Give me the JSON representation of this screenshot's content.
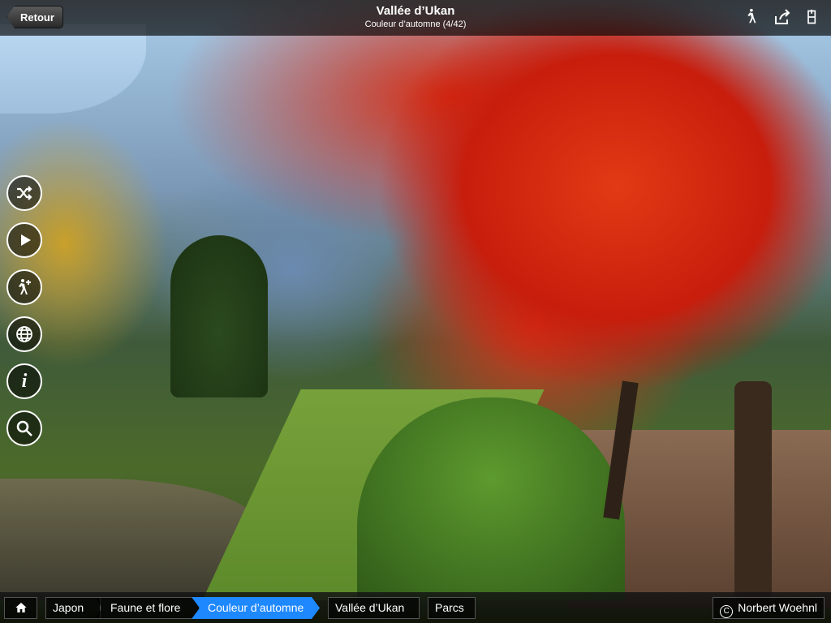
{
  "header": {
    "back_label": "Retour",
    "title": "Vallée d’Ukan",
    "subtitle": "Couleur d’automne (4/42)",
    "icons": [
      "walking-icon",
      "share-icon",
      "bookmark-icon"
    ]
  },
  "side_buttons": [
    {
      "name": "shuffle-icon"
    },
    {
      "name": "play-icon"
    },
    {
      "name": "add-walk-icon"
    },
    {
      "name": "globe-icon"
    },
    {
      "name": "info-icon",
      "glyph": "i"
    },
    {
      "name": "search-icon"
    }
  ],
  "breadcrumb": {
    "home_icon": "home-icon",
    "items": [
      "Japon",
      "Faune et flore",
      "Couleur d’automne"
    ]
  },
  "tags": [
    "Vallée d’Ukan",
    "Parcs"
  ],
  "copyright": {
    "symbol": "C",
    "author": "Norbert Woehnl"
  },
  "colors": {
    "active_crumb": "#1e88ff"
  }
}
